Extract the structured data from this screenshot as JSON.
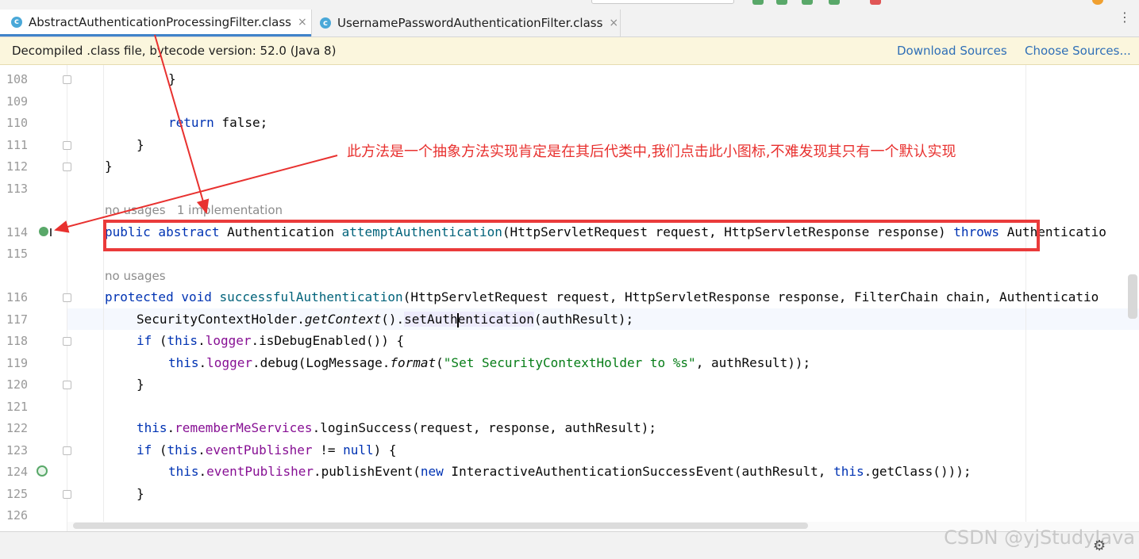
{
  "tabs": [
    {
      "label": "AbstractAuthenticationProcessingFilter.class",
      "active": true,
      "icon": "class-icon"
    },
    {
      "label": "UsernamePasswordAuthenticationFilter.class",
      "active": false,
      "icon": "class-icon"
    }
  ],
  "banner": {
    "message": "Decompiled .class file, bytecode version: 52.0 (Java 8)",
    "download_sources": "Download Sources",
    "choose_sources": "Choose Sources..."
  },
  "hints": {
    "h114_usages": "no usages",
    "h114_impl": "1 implementation",
    "h116_usages": "no usages"
  },
  "lines": {
    "l108": "108",
    "l109": "109",
    "l110": "110",
    "l111": "111",
    "l112": "112",
    "l113": "113",
    "l114": "114",
    "l115": "115",
    "l116": "116",
    "l117": "117",
    "l118": "118",
    "l119": "119",
    "l120": "120",
    "l121": "121",
    "l122": "122",
    "l123": "123",
    "l124": "124",
    "l125": "125",
    "l126": "126"
  },
  "code": {
    "c108": "}",
    "c110_kw": "return",
    "c110_rest": " false;",
    "c111": "}",
    "c112": "}",
    "c114_kw": "public abstract",
    "c114_type": " Authentication ",
    "c114_fn": "attemptAuthentication",
    "c114_params": "(HttpServletRequest request, HttpServletResponse response) ",
    "c114_throws": "throws",
    "c114_tail": " Authenticatio",
    "c116_kw": "protected void",
    "c116_fn": " successfulAuthentication",
    "c116_params": "(HttpServletRequest request, HttpServletResponse response, FilterChain chain, Authenticatio",
    "c117_a": "SecurityContextHolder.",
    "c117_b": "getContext",
    "c117_c": "().",
    "c117_d1": "setAuth",
    "c117_d2": "entication",
    "c117_e": "(authResult);",
    "c118_kw": "if",
    "c118_a": " (",
    "c118_this": "this",
    "c118_b": ".",
    "c118_fld": "logger",
    "c118_c": ".isDebugEnabled()) {",
    "c119_this": "this",
    "c119_a": ".",
    "c119_fld": "logger",
    "c119_b": ".debug(LogMessage.",
    "c119_fmt": "format",
    "c119_c": "(",
    "c119_str": "\"Set SecurityContextHolder to %s\"",
    "c119_d": ", authResult));",
    "c120": "}",
    "c122_this": "this",
    "c122_a": ".",
    "c122_fld": "rememberMeServices",
    "c122_b": ".loginSuccess(request, response, authResult);",
    "c123_kw": "if",
    "c123_a": " (",
    "c123_this": "this",
    "c123_b": ".",
    "c123_fld": "eventPublisher",
    "c123_c": " != ",
    "c123_null": "null",
    "c123_d": ") {",
    "c124_this": "this",
    "c124_a": ".",
    "c124_fld": "eventPublisher",
    "c124_b": ".publishEvent(",
    "c124_new": "new",
    "c124_c": " InteractiveAuthenticationSuccessEvent(authResult, ",
    "c124_this2": "this",
    "c124_d": ".getClass()));",
    "c125": "}"
  },
  "annotation": {
    "text": "此方法是一个抽象方法实现肯定是在其后代类中,我们点击此小图标,不难发现其只有一个默认实现",
    "color": "#e8312f"
  },
  "watermark": "CSDN @yjStudyJava"
}
